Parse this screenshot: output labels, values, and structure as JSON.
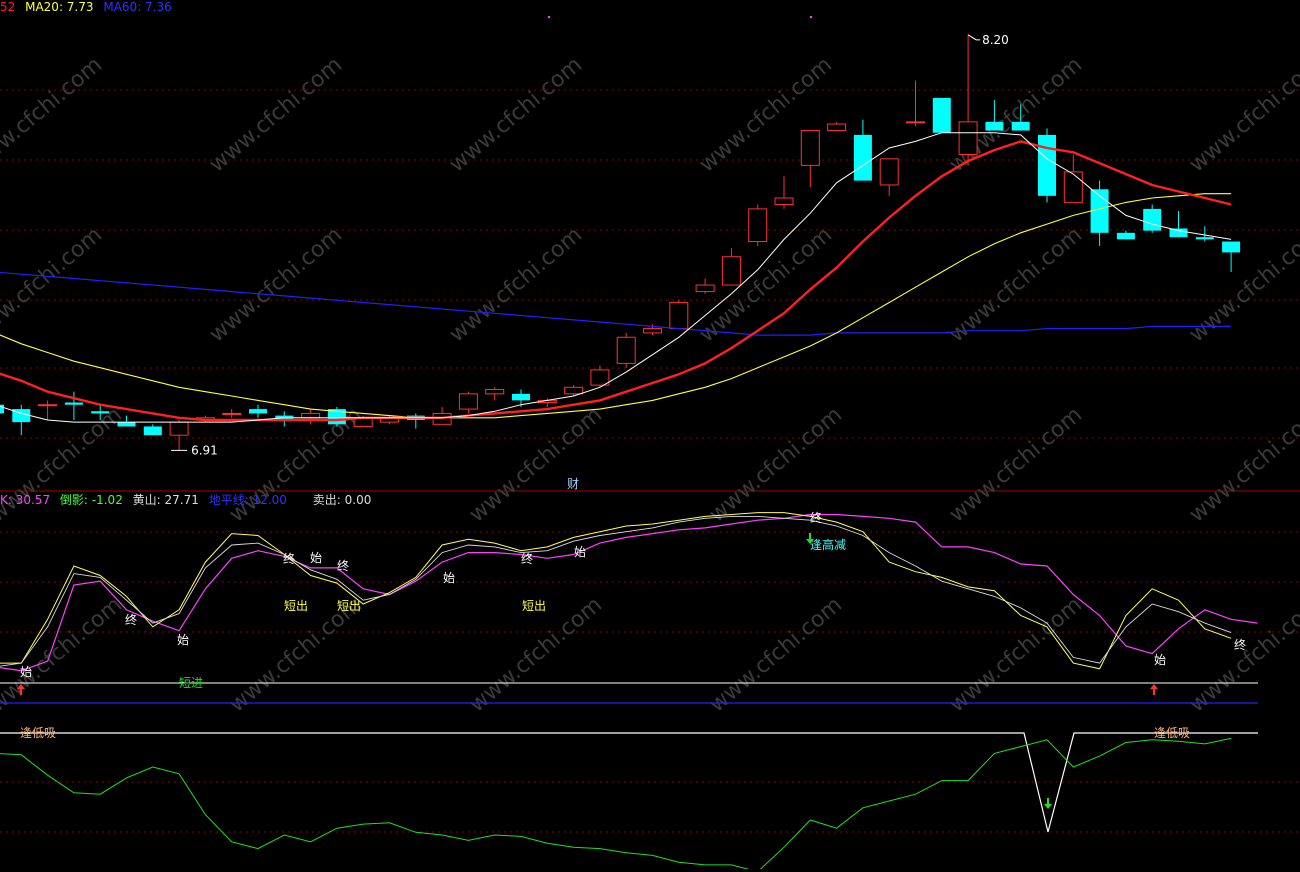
{
  "header": [
    {
      "text": "52",
      "color": "#ff2020"
    },
    {
      "text": "MA20: 7.73",
      "color": "#ffff40"
    },
    {
      "text": "MA60: 7.36",
      "color": "#3030ff"
    }
  ],
  "indicator_header": [
    {
      "text": "K: 30.57",
      "color": "#ff40ff"
    },
    {
      "text": "倒影: -1.02",
      "color": "#40ff40"
    },
    {
      "text": "黄山: 27.71",
      "color": "#dcdcdc"
    },
    {
      "text": "地平线: 12.00",
      "color": "#3030ff"
    },
    {
      "text": "卖出: 0.00",
      "color": "#dcdcdc"
    }
  ],
  "watermark": "www.cfchi.com",
  "annotations": {
    "high_label": "8.20",
    "low_label": "6.91",
    "cai_label": "财"
  },
  "signal_labels": {
    "start": "始",
    "end": "终",
    "short_out": "短出",
    "short_in": "短进",
    "high_reduce": "逢高减",
    "low_buy": "逢低吸"
  },
  "colors": {
    "up": "#ff3030",
    "down": "#00ffff",
    "ma5": "#ffffff",
    "ma10": "#ff2020",
    "ma20": "#ffff40",
    "ma60": "#2020ff",
    "k": "#ff40ff",
    "yellow": "#ffff60",
    "white": "#ffffff",
    "green": "#20e020",
    "grid": "#8b0000",
    "separator": "#b00000"
  },
  "chart_data": [
    {
      "type": "candlestick",
      "x": [
        1,
        2,
        3,
        4,
        5,
        6,
        7,
        8,
        9,
        10,
        11,
        12,
        13,
        14,
        15,
        16,
        17,
        18,
        19,
        20,
        21,
        22,
        23,
        24,
        25,
        26,
        27,
        28,
        29,
        30,
        31,
        32,
        33,
        34,
        35,
        36,
        37,
        38,
        39,
        40,
        41,
        42,
        43,
        44,
        45,
        46,
        47,
        48
      ],
      "ohlc": [
        [
          7.12,
          7.22,
          7.06,
          7.08
        ],
        [
          7.1,
          7.12,
          6.98,
          7.04
        ],
        [
          7.12,
          7.14,
          7.05,
          7.12
        ],
        [
          7.13,
          7.18,
          7.05,
          7.12
        ],
        [
          7.09,
          7.12,
          7.05,
          7.08
        ],
        [
          7.04,
          7.07,
          7.02,
          7.02
        ],
        [
          7.02,
          7.03,
          6.98,
          6.98
        ],
        [
          6.98,
          7.05,
          6.91,
          7.04
        ],
        [
          7.05,
          7.07,
          7.04,
          7.06
        ],
        [
          7.08,
          7.1,
          7.06,
          7.08
        ],
        [
          7.1,
          7.12,
          7.06,
          7.08
        ],
        [
          7.07,
          7.09,
          7.02,
          7.05
        ],
        [
          7.06,
          7.1,
          7.03,
          7.08
        ],
        [
          7.1,
          7.11,
          7.02,
          7.03
        ],
        [
          7.02,
          7.07,
          7.02,
          7.06
        ],
        [
          7.04,
          7.07,
          7.03,
          7.06
        ],
        [
          7.07,
          7.08,
          7.01,
          7.05
        ],
        [
          7.03,
          7.11,
          7.03,
          7.08
        ],
        [
          7.1,
          7.18,
          7.08,
          7.17
        ],
        [
          7.17,
          7.2,
          7.14,
          7.19
        ],
        [
          7.17,
          7.19,
          7.11,
          7.14
        ],
        [
          7.13,
          7.15,
          7.11,
          7.14
        ],
        [
          7.17,
          7.21,
          7.16,
          7.2
        ],
        [
          7.21,
          7.3,
          7.2,
          7.28
        ],
        [
          7.31,
          7.45,
          7.29,
          7.43
        ],
        [
          7.45,
          7.49,
          7.44,
          7.47
        ],
        [
          7.47,
          7.6,
          7.47,
          7.59
        ],
        [
          7.64,
          7.7,
          7.63,
          7.67
        ],
        [
          7.67,
          7.84,
          7.67,
          7.8
        ],
        [
          7.87,
          8.04,
          7.85,
          8.02
        ],
        [
          8.04,
          8.17,
          8.02,
          8.07
        ],
        [
          8.22,
          8.34,
          8.12,
          8.38
        ],
        [
          8.38,
          8.42,
          8.41,
          8.41
        ],
        [
          8.36,
          8.43,
          8.15,
          8.15
        ],
        [
          8.13,
          8.24,
          8.08,
          8.25
        ],
        [
          8.42,
          8.61,
          8.4,
          8.42
        ],
        [
          8.53,
          8.53,
          8.37,
          8.37
        ],
        [
          8.27,
          8.82,
          8.22,
          8.42
        ],
        [
          8.42,
          8.52,
          8.4,
          8.38
        ],
        [
          8.42,
          8.5,
          8.38,
          8.38
        ],
        [
          8.36,
          8.39,
          8.05,
          8.08
        ],
        [
          8.05,
          8.27,
          8.07,
          8.19
        ],
        [
          8.11,
          8.15,
          7.85,
          7.91
        ],
        [
          7.91,
          7.92,
          7.88,
          7.88
        ],
        [
          8.02,
          8.04,
          7.91,
          7.92
        ],
        [
          7.93,
          8.01,
          7.89,
          7.89
        ],
        [
          7.89,
          7.94,
          7.87,
          7.88
        ],
        [
          7.87,
          7.86,
          7.73,
          7.82
        ]
      ],
      "ma5": [
        7.12,
        7.08,
        7.05,
        7.04,
        7.04,
        7.04,
        7.04,
        7.04,
        7.04,
        7.04,
        7.05,
        7.06,
        7.06,
        7.06,
        7.06,
        7.06,
        7.06,
        7.06,
        7.07,
        7.09,
        7.12,
        7.14,
        7.16,
        7.2,
        7.27,
        7.35,
        7.43,
        7.53,
        7.63,
        7.74,
        7.88,
        8.0,
        8.14,
        8.22,
        8.3,
        8.33,
        8.37,
        8.37,
        8.37,
        8.36,
        8.25,
        8.18,
        8.08,
        7.99,
        7.95,
        7.92,
        7.9,
        7.88
      ],
      "ma10": [
        7.27,
        7.23,
        7.18,
        7.15,
        7.12,
        7.1,
        7.08,
        7.06,
        7.05,
        7.05,
        7.05,
        7.05,
        7.05,
        7.05,
        7.06,
        7.06,
        7.06,
        7.06,
        7.07,
        7.08,
        7.09,
        7.1,
        7.12,
        7.14,
        7.18,
        7.22,
        7.26,
        7.31,
        7.38,
        7.46,
        7.54,
        7.65,
        7.75,
        7.87,
        7.98,
        8.08,
        8.17,
        8.24,
        8.29,
        8.33,
        8.3,
        8.28,
        8.23,
        8.18,
        8.13,
        8.1,
        8.07,
        8.04
      ],
      "ma20": [
        7.45,
        7.4,
        7.36,
        7.32,
        7.29,
        7.26,
        7.23,
        7.2,
        7.18,
        7.16,
        7.14,
        7.12,
        7.1,
        7.09,
        7.08,
        7.07,
        7.06,
        7.06,
        7.06,
        7.06,
        7.07,
        7.08,
        7.09,
        7.1,
        7.12,
        7.14,
        7.17,
        7.2,
        7.24,
        7.29,
        7.34,
        7.39,
        7.45,
        7.52,
        7.59,
        7.66,
        7.73,
        7.8,
        7.86,
        7.91,
        7.95,
        7.99,
        8.02,
        8.05,
        8.07,
        8.08,
        8.09,
        8.09
      ],
      "ma60": [
        7.73,
        7.72,
        7.71,
        7.7,
        7.69,
        7.68,
        7.67,
        7.66,
        7.65,
        7.64,
        7.63,
        7.62,
        7.61,
        7.6,
        7.59,
        7.58,
        7.57,
        7.56,
        7.55,
        7.54,
        7.53,
        7.52,
        7.51,
        7.5,
        7.49,
        7.48,
        7.47,
        7.46,
        7.45,
        7.44,
        7.44,
        7.44,
        7.45,
        7.45,
        7.45,
        7.45,
        7.45,
        7.46,
        7.46,
        7.46,
        7.47,
        7.47,
        7.47,
        7.47,
        7.48,
        7.48,
        7.48,
        7.48
      ],
      "ylim": [
        6.82,
        8.98
      ]
    },
    {
      "type": "line",
      "ylim": [
        -5,
        100
      ],
      "k": [
        15,
        13,
        18,
        58,
        60,
        45,
        39,
        34,
        56,
        72,
        76,
        73,
        67,
        67,
        56,
        53,
        60,
        70,
        75,
        75,
        74,
        72,
        74,
        80,
        83,
        85,
        87,
        88,
        90,
        92,
        93,
        95,
        95,
        94,
        93,
        91,
        78,
        78,
        75,
        69,
        68,
        53,
        42,
        26,
        22,
        35,
        45,
        40,
        38
      ],
      "yellow": [
        17,
        17,
        40,
        68,
        63,
        52,
        36,
        45,
        70,
        85,
        84,
        74,
        63,
        59,
        48,
        54,
        62,
        79,
        82,
        80,
        76,
        78,
        83,
        86,
        89,
        90,
        92,
        94,
        95,
        96,
        96,
        94,
        91,
        86,
        70,
        65,
        62,
        57,
        55,
        42,
        36,
        17,
        14,
        42,
        56,
        50,
        35,
        30
      ],
      "white": [
        15,
        17,
        36,
        64,
        62,
        50,
        38,
        43,
        67,
        79,
        80,
        74,
        66,
        61,
        50,
        53,
        61,
        75,
        79,
        78,
        75,
        76,
        81,
        84,
        86,
        88,
        91,
        93,
        94,
        94,
        93,
        92,
        89,
        84,
        75,
        68,
        60,
        56,
        52,
        46,
        38,
        20,
        17,
        36,
        48,
        44,
        38,
        33
      ]
    },
    {
      "type": "line",
      "ylim": [
        0,
        100
      ],
      "green": [
        85,
        84,
        69,
        56,
        55,
        67,
        75,
        70,
        40,
        20,
        15,
        25,
        20,
        30,
        33,
        34,
        27,
        25,
        21,
        25,
        24,
        19,
        16,
        15,
        12,
        10,
        5,
        3,
        3,
        -2,
        16,
        36,
        30,
        45,
        50,
        55,
        65,
        65,
        85,
        90,
        95,
        75,
        83,
        93,
        95,
        94,
        92,
        96
      ]
    }
  ]
}
